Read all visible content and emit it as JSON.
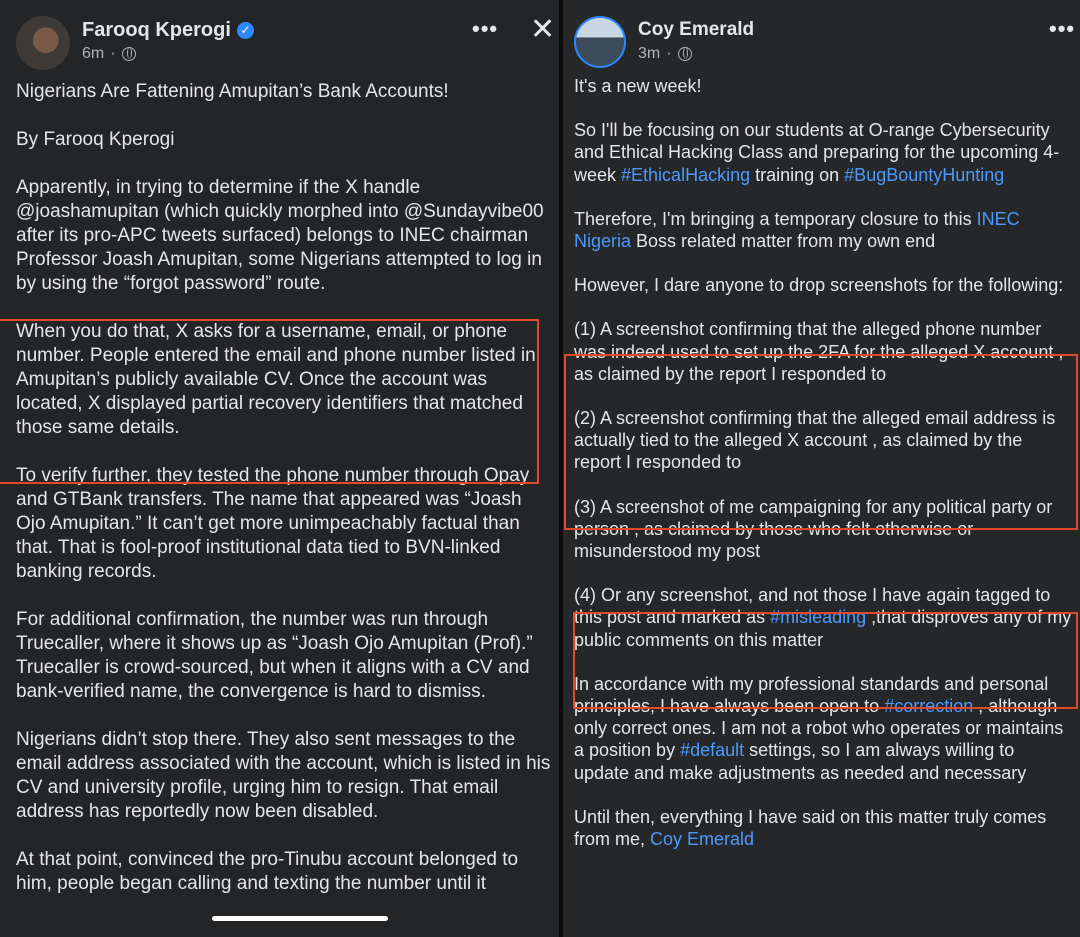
{
  "left_post": {
    "author": "Farooq Kperogi",
    "time": "6m",
    "paragraphs": [
      "Nigerians Are Fattening Amupitan’s Bank Accounts!",
      "By Farooq Kperogi",
      "Apparently, in trying to determine if the X handle @joashamupitan (which quickly morphed into @Sundayvibe00 after its pro-APC tweets surfaced) belongs to INEC chairman Professor Joash Amupitan, some Nigerians attempted to log in by using the “forgot password” route.",
      "When you do that, X asks for a username, email, or phone number. People entered the email and phone number listed in Amupitan’s publicly available CV. Once the account was located, X displayed partial recovery identifiers that matched those same details.",
      "To verify further, they tested the phone number through Opay and GTBank transfers. The name that appeared was “Joash Ojo Amupitan.” It can’t get more unimpeachably factual than that. That is fool-proof institutional data tied to BVN-linked banking records.",
      "For additional confirmation, the number was run through Truecaller, where it shows up as “Joash Ojo Amupitan (Prof).” Truecaller is crowd-sourced, but when it aligns with a CV and bank-verified name, the convergence is hard to dismiss.",
      "Nigerians didn’t stop there. They also sent messages to the email address associated with the account, which is listed in his CV and university profile, urging him to resign. That email address has reportedly now been disabled.",
      "At that point, convinced the pro-Tinubu account belonged to him, people began calling and texting the number until it"
    ]
  },
  "right_post": {
    "author": "Coy Emerald",
    "time": "3m",
    "p1": "It's a new week!",
    "p2_a": "So I'll be focusing on our students at O-range Cybersecurity and Ethical Hacking Class and preparing for the upcoming 4-week ",
    "p2_tag1": "#EthicalHacking",
    "p2_b": " training on ",
    "p2_tag2": "#BugBountyHunting",
    "p3_a": "Therefore, I'm bringing a temporary closure to this ",
    "p3_link": "INEC Nigeria",
    "p3_b": " Boss related matter from my own end",
    "p4": "However, I dare anyone to drop screenshots for the following:",
    "p5": "(1) A screenshot confirming that the alleged phone number was indeed used to set up the 2FA for the alleged X account , as claimed by the report I responded to",
    "p6": "(2) A screenshot confirming that the alleged email address is actually tied to the alleged X account , as claimed by the report I responded to",
    "p7": "(3) A screenshot of me campaigning for any political party or person , as claimed by those who felt otherwise or misunderstood my post",
    "p8_a": "(4) Or any screenshot,  and not those I have again tagged to this post and marked as ",
    "p8_tag": "#misleading",
    "p8_b": " ,that disproves any of my public comments on this matter",
    "p9_a": "In accordance with my professional standards and personal principles, I have always been open to ",
    "p9_tag1": "#correction",
    "p9_b": " , although only correct ones. I am not a robot who operates or maintains a position by ",
    "p9_tag2": "#default",
    "p9_c": " settings, so I am always willing to update and make adjustments as needed and necessary",
    "p10_a": "Until then, everything I have said on this matter truly comes from me, ",
    "p10_link": "Coy Emerald"
  },
  "icons": {
    "more": "•••",
    "close": "✕",
    "verified": "✓",
    "dot": "·"
  },
  "colors": {
    "background": "#242526",
    "highlight_box": "#e0492c",
    "link": "#4b9bff",
    "verified": "#2d88ff"
  }
}
